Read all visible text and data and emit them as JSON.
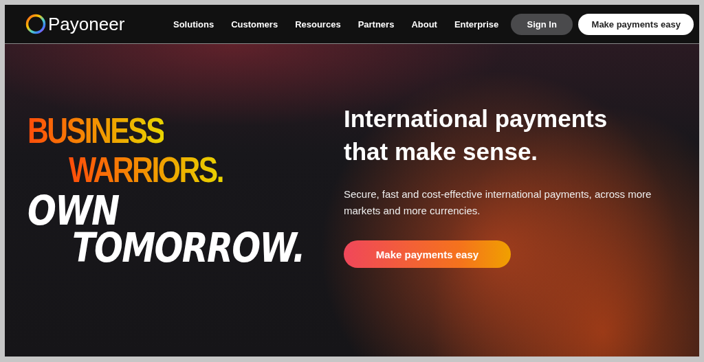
{
  "header": {
    "logo": "Payoneer",
    "nav": [
      {
        "label": "Solutions"
      },
      {
        "label": "Customers"
      },
      {
        "label": "Resources"
      },
      {
        "label": "Partners"
      },
      {
        "label": "About"
      },
      {
        "label": "Enterprise"
      }
    ],
    "sign_in": "Sign In",
    "cta": "Make payments easy"
  },
  "hero": {
    "slogan_lines": [
      {
        "text": "BUSINESS",
        "kind": "gradient"
      },
      {
        "text": "WARRIORS.",
        "kind": "gradient"
      },
      {
        "text": "OWN",
        "kind": "brush"
      },
      {
        "text": "TOMORROW.",
        "kind": "brush"
      }
    ],
    "title": "International payments that make sense.",
    "subtitle": "Secure, fast and cost-effective international payments, across more markets and more currencies.",
    "cta": "Make payments easy"
  }
}
